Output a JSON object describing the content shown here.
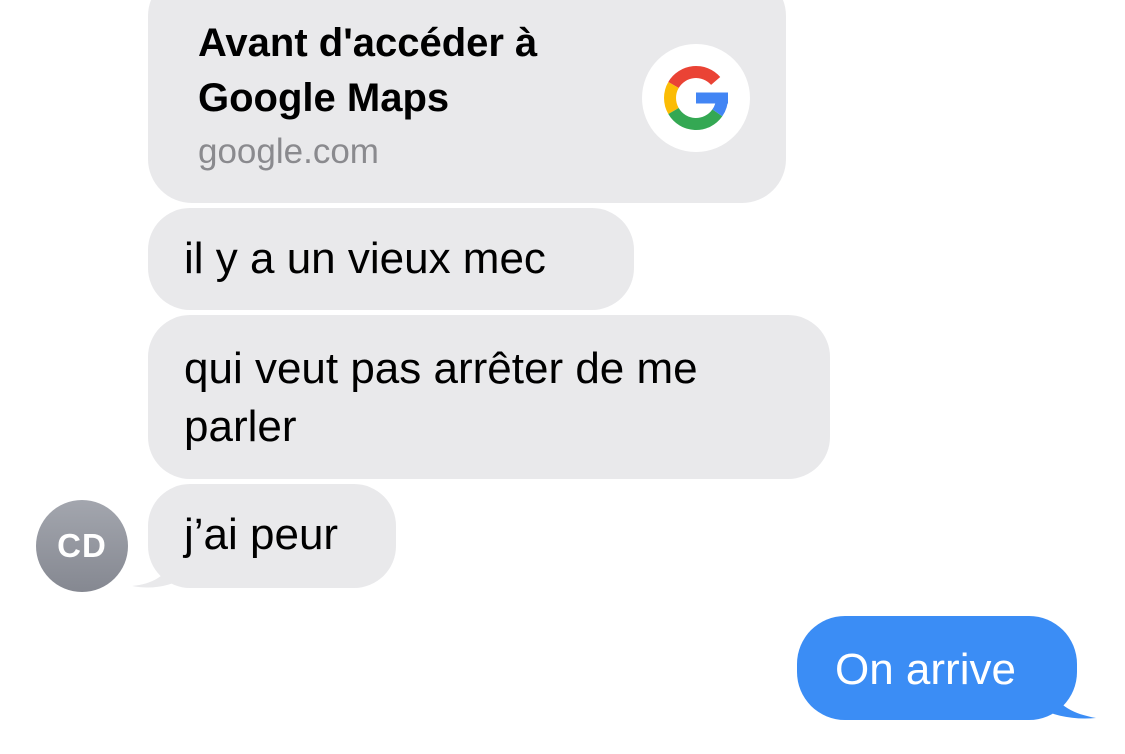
{
  "link_preview": {
    "title": "Avant d'accéder à Google Maps",
    "domain": "google.com",
    "icon": "google-g-icon"
  },
  "messages": [
    {
      "direction": "incoming",
      "text": "il y a un vieux mec"
    },
    {
      "direction": "incoming",
      "text": "qui veut pas arrêter de me parler"
    },
    {
      "direction": "incoming",
      "text": "j’ai peur"
    },
    {
      "direction": "outgoing",
      "text": "On arrive"
    }
  ],
  "sender": {
    "initials": "CD"
  },
  "colors": {
    "incoming_bubble": "#e9e9eb",
    "outgoing_bubble": "#3b8df5",
    "avatar": "#9a9da5",
    "domain_text": "#8a8a8e"
  }
}
